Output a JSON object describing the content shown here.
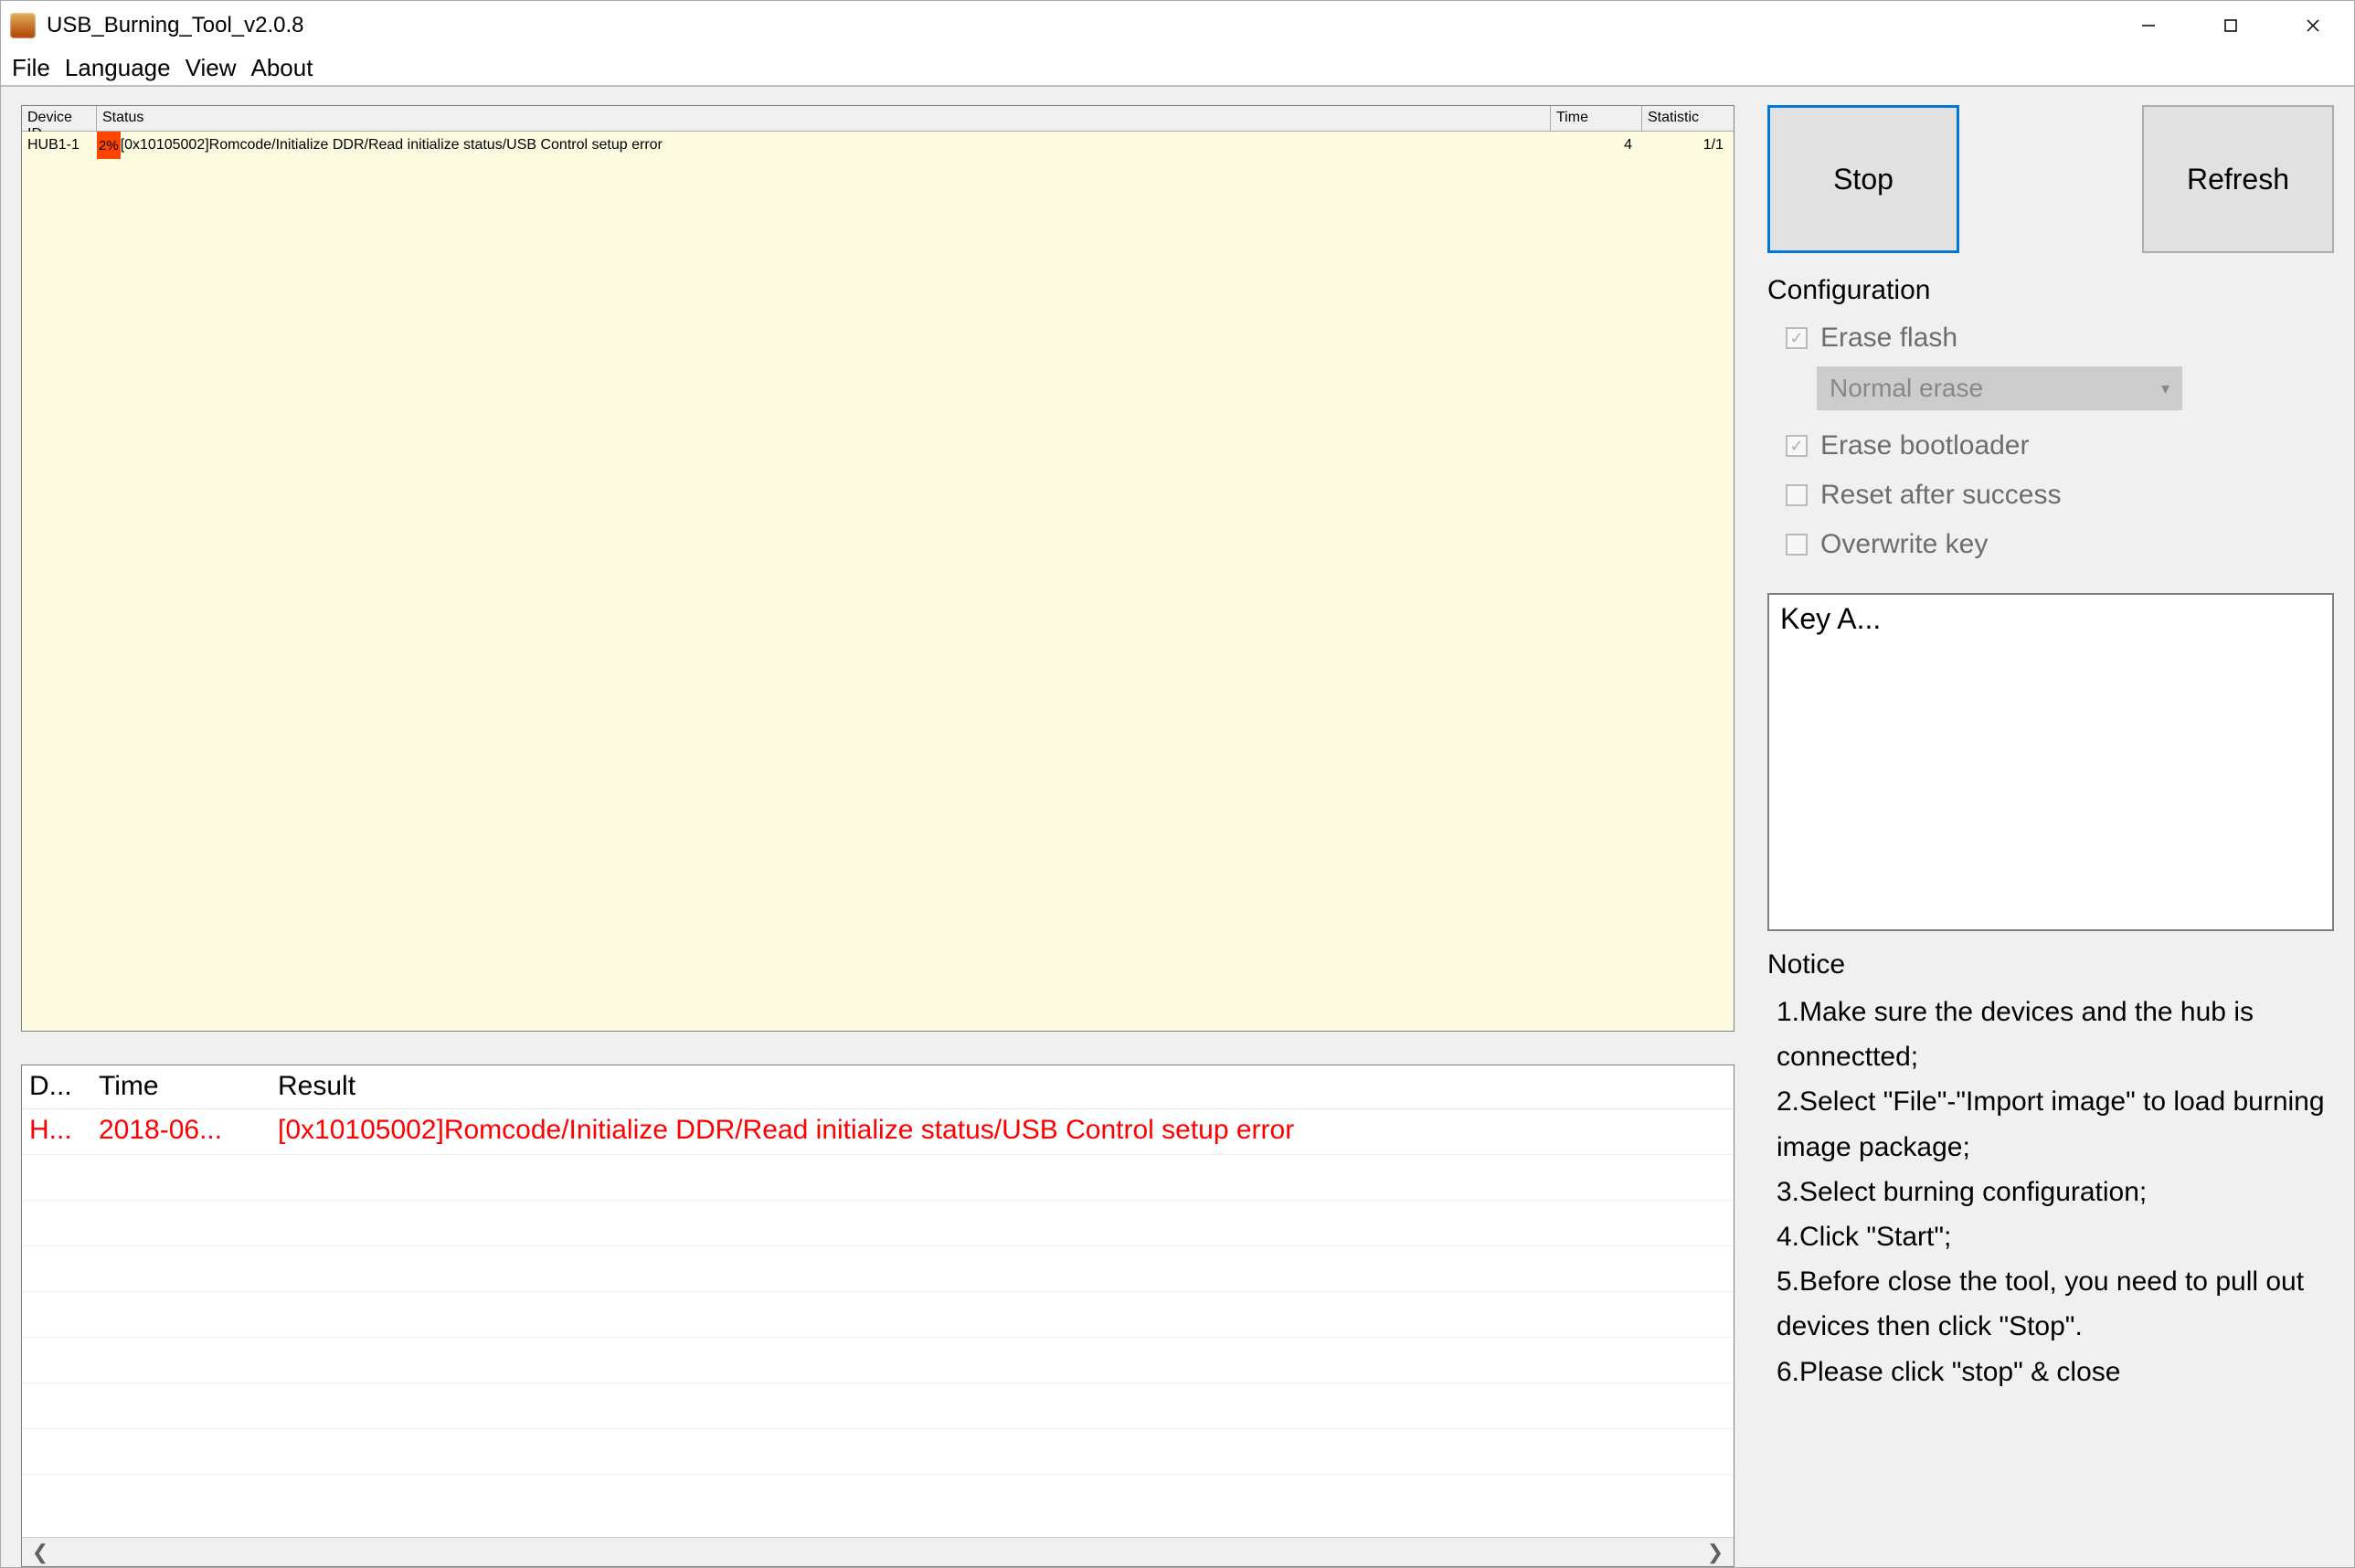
{
  "title": "USB_Burning_Tool_v2.0.8",
  "menu": {
    "file": "File",
    "language": "Language",
    "view": "View",
    "about": "About"
  },
  "deviceTable": {
    "headers": {
      "device": "Device ID",
      "status": "Status",
      "time": "Time",
      "stat": "Statistic"
    },
    "rows": [
      {
        "device": "HUB1-1",
        "progress": "2%",
        "msg": "[0x10105002]Romcode/Initialize DDR/Read initialize status/USB Control setup error",
        "time": "4",
        "stat": "1/1"
      }
    ]
  },
  "resultTable": {
    "headers": {
      "d": "D...",
      "time": "Time",
      "result": "Result"
    },
    "rows": [
      {
        "d": "H...",
        "time": "2018-06...",
        "result": "[0x10105002]Romcode/Initialize DDR/Read initialize status/USB Control setup error"
      }
    ]
  },
  "buttons": {
    "stop": "Stop",
    "refresh": "Refresh"
  },
  "config": {
    "title": "Configuration",
    "eraseFlash": "Erase flash",
    "eraseMode": "Normal erase",
    "eraseBootloader": "Erase bootloader",
    "resetAfter": "Reset after success",
    "overwriteKey": "Overwrite key"
  },
  "keyBox": "Key A...",
  "notice": {
    "title": "Notice",
    "body": "1.Make sure the devices and the hub is connectted;\n2.Select \"File\"-\"Import image\" to load burning image package;\n3.Select burning configuration;\n4.Click \"Start\";\n5.Before close the tool, you need to pull out devices then click \"Stop\".\n6.Please click \"stop\" & close"
  }
}
